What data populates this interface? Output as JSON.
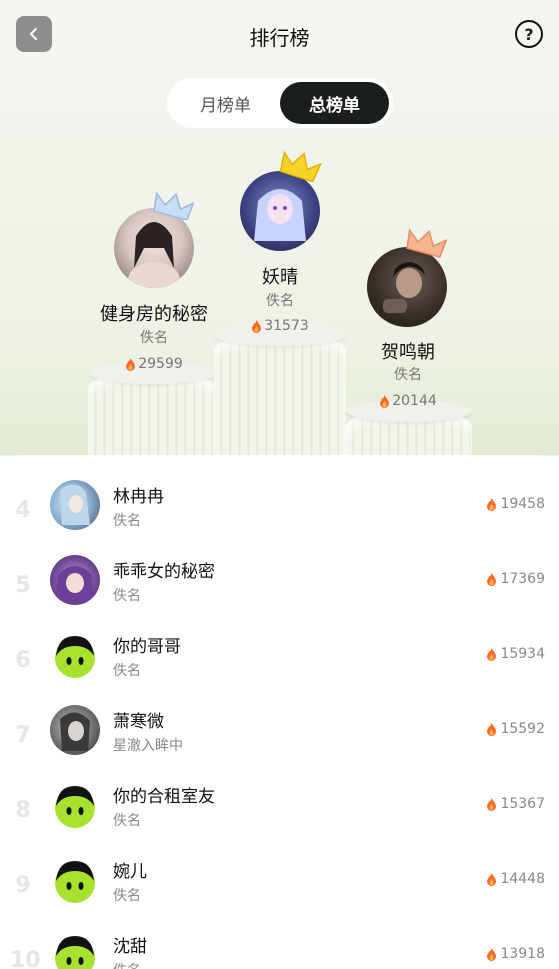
{
  "header": {
    "title": "排行榜",
    "back_icon": "chevron-left-icon",
    "help_icon": "question-circle-icon",
    "help_glyph": "?"
  },
  "tabs": [
    {
      "label": "月榜单",
      "active": false
    },
    {
      "label": "总榜单",
      "active": true
    }
  ],
  "podium": {
    "first": {
      "name": "妖晴",
      "sub": "佚名",
      "score": "31573"
    },
    "second": {
      "name": "健身房的秘密",
      "sub": "佚名",
      "score": "29599"
    },
    "third": {
      "name": "贺鸣朝",
      "sub": "佚名",
      "score": "20144"
    }
  },
  "list": [
    {
      "rank": "4",
      "name": "林冉冉",
      "sub": "佚名",
      "score": "19458"
    },
    {
      "rank": "5",
      "name": "乖乖女的秘密",
      "sub": "佚名",
      "score": "17369"
    },
    {
      "rank": "6",
      "name": "你的哥哥",
      "sub": "佚名",
      "score": "15934"
    },
    {
      "rank": "7",
      "name": "萧寒微",
      "sub": "星澈入眸中",
      "score": "15592"
    },
    {
      "rank": "8",
      "name": "你的合租室友",
      "sub": "佚名",
      "score": "15367"
    },
    {
      "rank": "9",
      "name": "婉儿",
      "sub": "佚名",
      "score": "14448"
    },
    {
      "rank": "10",
      "name": "沈甜",
      "sub": "佚名",
      "score": "13918"
    }
  ],
  "colors": {
    "accent_dark": "#1a1f1c",
    "flame": "#ff6a2b",
    "crown_gold": "#f5c518",
    "crown_silver": "#b8d4f0",
    "crown_bronze": "#f0a878"
  }
}
